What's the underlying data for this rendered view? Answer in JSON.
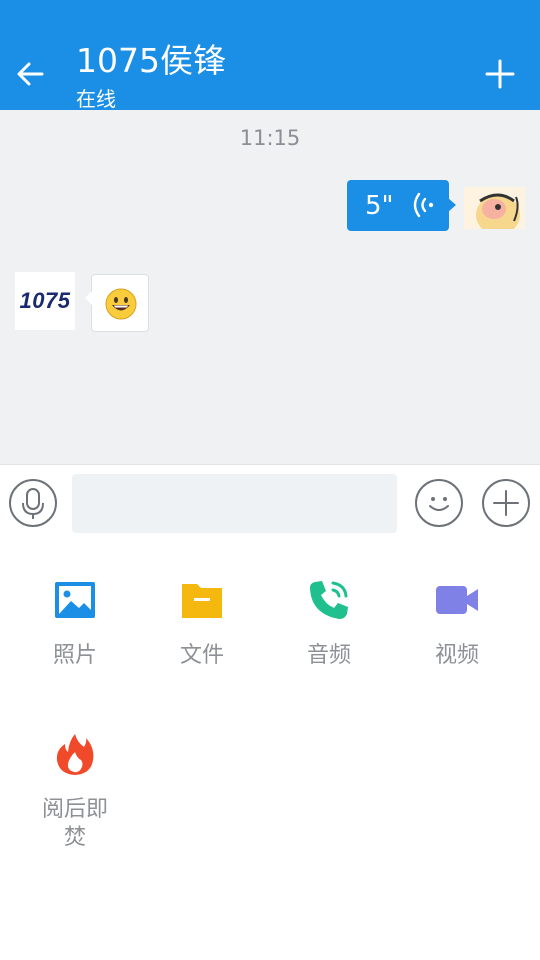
{
  "header": {
    "title": "1075侯锋",
    "status": "在线"
  },
  "chat": {
    "timestamp": "11:15",
    "messages": [
      {
        "from": "me",
        "type": "voice",
        "duration": "5\""
      },
      {
        "from": "other",
        "type": "emoji",
        "avatar_text": "1075"
      }
    ]
  },
  "input": {
    "placeholder": "",
    "value": ""
  },
  "tools": [
    {
      "label": "照片",
      "icon": "photo-icon"
    },
    {
      "label": "文件",
      "icon": "folder-icon"
    },
    {
      "label": "音频",
      "icon": "phone-call-icon"
    },
    {
      "label": "视频",
      "icon": "video-camera-icon"
    },
    {
      "label": "阅后即焚",
      "icon": "flame-icon"
    }
  ],
  "colors": {
    "primary": "#1b8fe6",
    "chat_bg": "#eff1f3",
    "photo": "#1b8fe6",
    "file": "#f5b80f",
    "audio": "#1fc08e",
    "video": "#7f81e6",
    "burn": "#f04a2a"
  }
}
